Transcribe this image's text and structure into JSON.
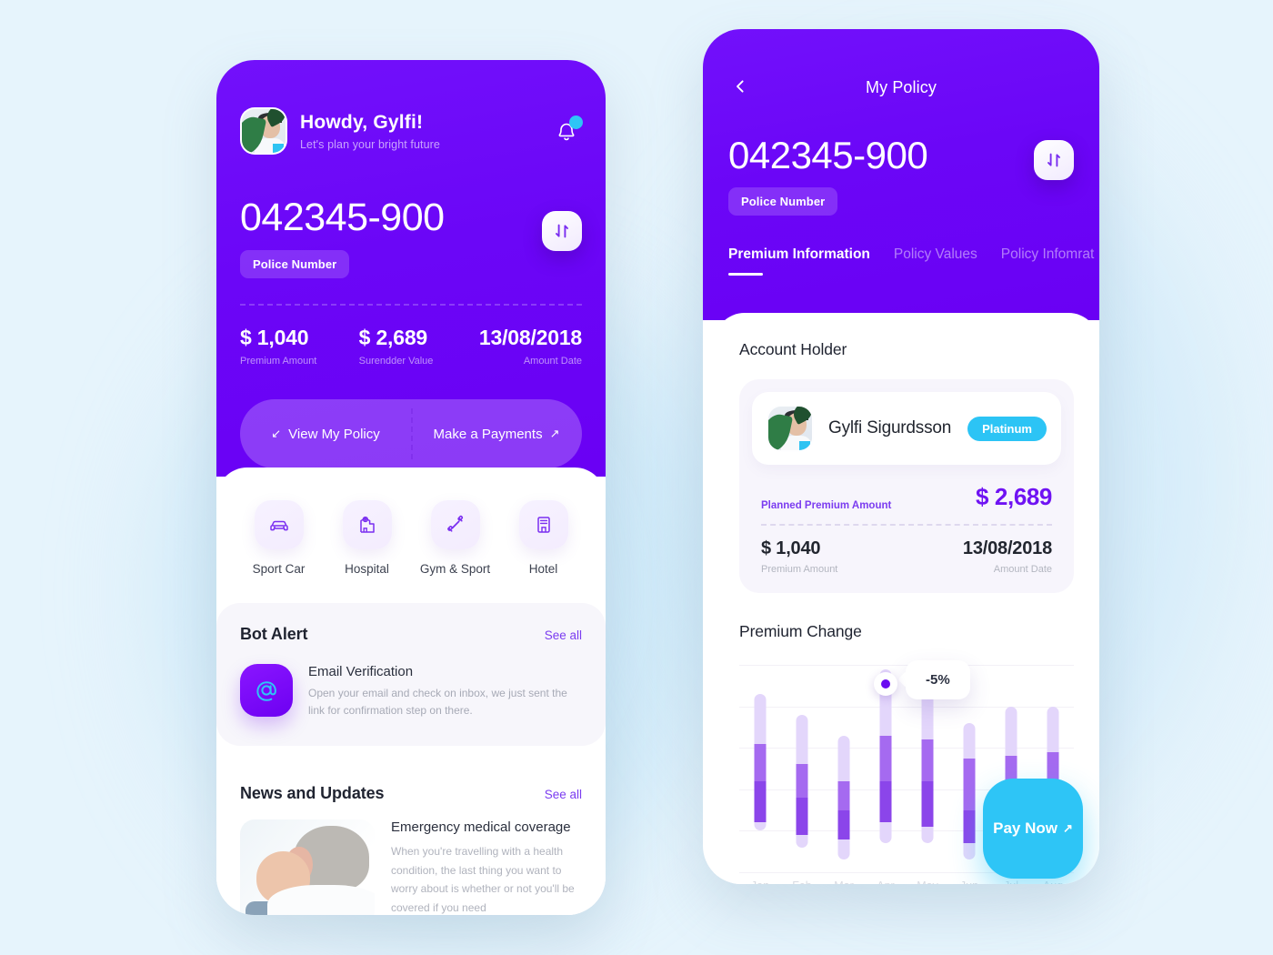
{
  "theme": {
    "background": "#e6f4fc",
    "purple": "#6a00f4",
    "purple_light": "#8b45ea",
    "accent_cyan": "#2ec5f6",
    "link": "#7b3cf0"
  },
  "home": {
    "greeting": "Howdy, Gylfi!",
    "subtitle": "Let's plan your bright future",
    "avatar_alt": "user-avatar",
    "bell_icon": "bell-icon",
    "swap_icon": "swap-vertical-icon",
    "policy_number": "042345-900",
    "policy_tag": "Police Number",
    "stats": [
      {
        "value": "$ 1,040",
        "label": "Premium Amount"
      },
      {
        "value": "$ 2,689",
        "label": "Surendder Value"
      },
      {
        "value": "13/08/2018",
        "label": "Amount Date"
      }
    ],
    "actions": [
      {
        "label": "View My Policy",
        "icon": "arrow-down-left-icon"
      },
      {
        "label": "Make a Payments",
        "icon": "arrow-up-right-icon"
      }
    ],
    "categories": [
      {
        "label": "Sport Car",
        "icon": "car-icon"
      },
      {
        "label": "Hospital",
        "icon": "hospital-icon"
      },
      {
        "label": "Gym & Sport",
        "icon": "dumbbell-icon"
      },
      {
        "label": "Hotel",
        "icon": "building-icon"
      }
    ],
    "bot_alert": {
      "title": "Bot Alert",
      "see_all": "See all",
      "item_icon": "at-sign-icon",
      "item_title": "Email Verification",
      "item_body": "Open your email and check on inbox, we just sent the link for confirmation step on there."
    },
    "news": {
      "title": "News and Updates",
      "see_all": "See all",
      "item_title": "Emergency medical coverage",
      "item_body": "When you're travelling with a health condition, the last thing you want to worry about is whether or not you'll be covered if you need"
    }
  },
  "policy": {
    "back_icon": "chevron-left-icon",
    "title": "My Policy",
    "policy_number": "042345-900",
    "policy_tag": "Police Number",
    "swap_icon": "swap-vertical-icon",
    "tabs": [
      {
        "label": "Premium Information",
        "active": true
      },
      {
        "label": "Policy Values",
        "active": false
      },
      {
        "label": "Policy Infomrat",
        "active": false
      }
    ],
    "account_holder": {
      "section_title": "Account Holder",
      "name": "Gylfi Sigurdsson",
      "badge": "Platinum",
      "planned_label": "Planned Premium Amount",
      "planned_value": "$ 2,689",
      "premium_value": "$ 1,040",
      "premium_label": "Premium Amount",
      "date_value": "13/08/2018",
      "date_label": "Amount Date"
    },
    "pay_now": {
      "label": "Pay Now",
      "icon": "arrow-up-right-icon"
    }
  },
  "chart_data": {
    "type": "bar",
    "title": "Premium Change",
    "xlabel": "",
    "ylabel": "",
    "grid": true,
    "legend": null,
    "categories": [
      "Jan",
      "Feb",
      "Mar",
      "Apr",
      "May",
      "Jun",
      "Jul",
      "Aug"
    ],
    "annotation": {
      "category": "Apr",
      "label": "-5%",
      "value": -5
    },
    "ylim": [
      0,
      100
    ],
    "series": [
      {
        "name": "Range (light)",
        "note": "full floating range of each month, % of plot height",
        "top": [
          86,
          76,
          66,
          98,
          94,
          72,
          80,
          80
        ],
        "bottom": [
          20,
          12,
          6,
          14,
          14,
          6,
          6,
          8
        ]
      },
      {
        "name": "Upper band",
        "note": "medium purple segment",
        "top": [
          62,
          52,
          44,
          66,
          64,
          55,
          56,
          58
        ],
        "bottom": [
          44,
          36,
          30,
          44,
          44,
          30,
          32,
          34
        ]
      },
      {
        "name": "Lower band",
        "note": "dark purple segment",
        "top": [
          44,
          36,
          30,
          44,
          44,
          30,
          32,
          34
        ],
        "bottom": [
          24,
          18,
          16,
          24,
          22,
          14,
          14,
          16
        ]
      }
    ]
  }
}
